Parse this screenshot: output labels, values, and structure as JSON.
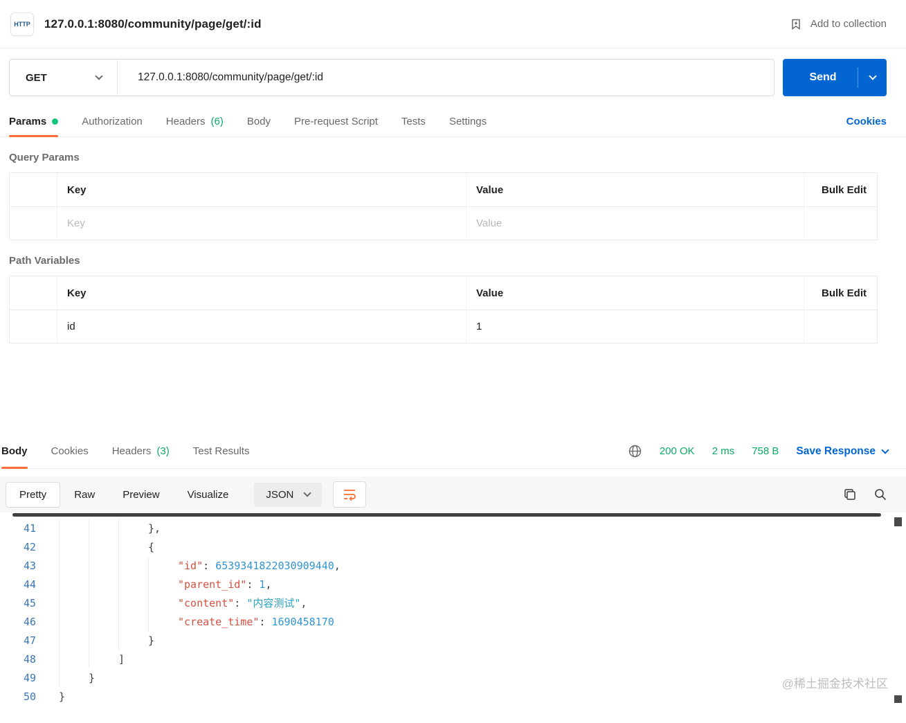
{
  "header": {
    "protocol_badge": "HTTP",
    "title": "127.0.0.1:8080/community/page/get/:id",
    "add_to_collection_label": "Add to collection"
  },
  "request": {
    "method": "GET",
    "url": "127.0.0.1:8080/community/page/get/:id",
    "send_label": "Send"
  },
  "request_tabs": {
    "params": "Params",
    "authorization": "Authorization",
    "headers": "Headers",
    "headers_count": "(6)",
    "body": "Body",
    "prerequest": "Pre-request Script",
    "tests": "Tests",
    "settings": "Settings",
    "cookies_link": "Cookies"
  },
  "query_params": {
    "title": "Query Params",
    "col_key": "Key",
    "col_value": "Value",
    "bulk_edit": "Bulk Edit",
    "placeholder_key": "Key",
    "placeholder_value": "Value"
  },
  "path_variables": {
    "title": "Path Variables",
    "col_key": "Key",
    "col_value": "Value",
    "bulk_edit": "Bulk Edit",
    "rows": [
      {
        "key": "id",
        "value": "1"
      }
    ]
  },
  "response": {
    "tabs": {
      "body": "Body",
      "cookies": "Cookies",
      "headers": "Headers",
      "headers_count": "(3)",
      "test_results": "Test Results"
    },
    "status": "200 OK",
    "time": "2 ms",
    "size": "758 B",
    "save_response_label": "Save Response",
    "view_modes": [
      "Pretty",
      "Raw",
      "Preview",
      "Visualize"
    ],
    "language": "JSON",
    "code": {
      "lines": [
        {
          "no": "41",
          "indent": 3,
          "segments": [
            {
              "text": "},",
              "type": "punct"
            }
          ]
        },
        {
          "no": "42",
          "indent": 3,
          "segments": [
            {
              "text": "{",
              "type": "punct"
            }
          ]
        },
        {
          "no": "43",
          "indent": 4,
          "segments": [
            {
              "text": "\"id\"",
              "type": "key"
            },
            {
              "text": ": ",
              "type": "punct"
            },
            {
              "text": "6539341822030909440",
              "type": "num"
            },
            {
              "text": ",",
              "type": "punct"
            }
          ]
        },
        {
          "no": "44",
          "indent": 4,
          "segments": [
            {
              "text": "\"parent_id\"",
              "type": "key"
            },
            {
              "text": ": ",
              "type": "punct"
            },
            {
              "text": "1",
              "type": "num"
            },
            {
              "text": ",",
              "type": "punct"
            }
          ]
        },
        {
          "no": "45",
          "indent": 4,
          "segments": [
            {
              "text": "\"content\"",
              "type": "key"
            },
            {
              "text": ": ",
              "type": "punct"
            },
            {
              "text": "\"内容测试\"",
              "type": "str"
            },
            {
              "text": ",",
              "type": "punct"
            }
          ]
        },
        {
          "no": "46",
          "indent": 4,
          "segments": [
            {
              "text": "\"create_time\"",
              "type": "key"
            },
            {
              "text": ": ",
              "type": "punct"
            },
            {
              "text": "1690458170",
              "type": "num"
            }
          ]
        },
        {
          "no": "47",
          "indent": 3,
          "segments": [
            {
              "text": "}",
              "type": "punct"
            }
          ]
        },
        {
          "no": "48",
          "indent": 2,
          "segments": [
            {
              "text": "]",
              "type": "punct"
            }
          ]
        },
        {
          "no": "49",
          "indent": 1,
          "segments": [
            {
              "text": "}",
              "type": "punct"
            }
          ]
        },
        {
          "no": "50",
          "indent": 0,
          "segments": [
            {
              "text": "}",
              "type": "punct"
            }
          ]
        }
      ]
    }
  },
  "watermark": "@稀土掘金技术社区"
}
